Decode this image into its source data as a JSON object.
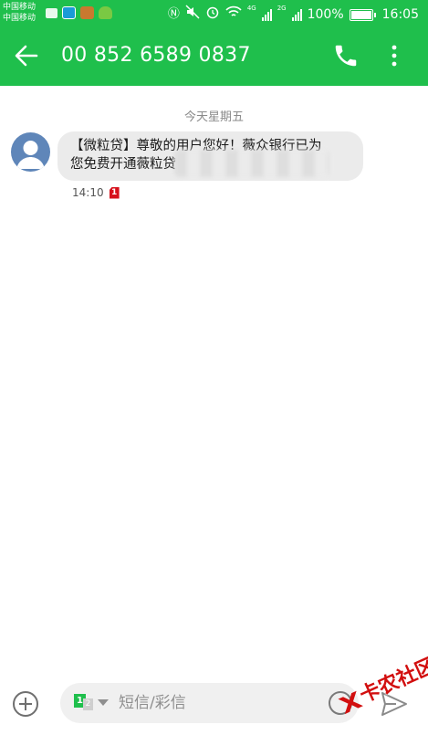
{
  "status_bar": {
    "carrier_1": "中国移动",
    "carrier_2": "中国移动",
    "network_1": "4G",
    "network_2": "2G",
    "battery": "100%",
    "battery_level": 1.0,
    "time": "16:05",
    "background_color": "#1fbf4c"
  },
  "header": {
    "title": "00 852 6589 0837",
    "back_icon": "arrow-left-icon",
    "call_icon": "phone-icon",
    "more_icon": "more-vertical-icon"
  },
  "conversation": {
    "date_separator": "今天星期五",
    "messages": [
      {
        "line_1": "【微粒贷】尊敬的用户您好！薇众银行已为",
        "line_2": "您免费开通薇粒贷",
        "time": "14:10",
        "sim": "1"
      }
    ]
  },
  "composer": {
    "sim_primary": "1",
    "sim_secondary": "2",
    "placeholder": "短信/彩信",
    "add_icon": "plus-circle-icon",
    "emoji_icon": "emoji-icon",
    "send_icon": "send-icon"
  },
  "watermark": {
    "text": "卡农社区"
  },
  "colors": {
    "accent": "#1fbf4c",
    "bubble": "#ebebeb",
    "sim_badge_red": "#d6101b",
    "watermark_red": "#d20f0f"
  }
}
